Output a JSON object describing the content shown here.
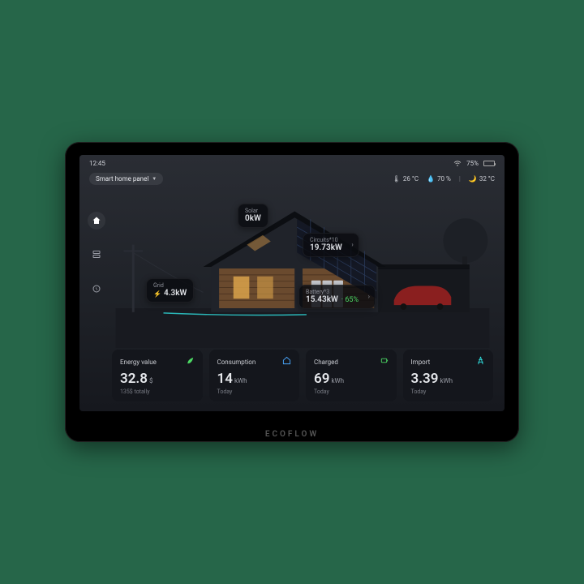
{
  "branding": "ECOFLOW",
  "statusbar": {
    "time": "12:45",
    "battery_pct": "75%"
  },
  "header": {
    "title": "Smart home panel",
    "temp": "26 °C",
    "humidity": "70 %",
    "outside_temp": "32 °C"
  },
  "scene": {
    "solar": {
      "label": "Solar",
      "value": "0kW"
    },
    "circuits": {
      "label": "Circuits*10",
      "value": "19.73kW"
    },
    "grid": {
      "label": "Grid",
      "value": "4.3kW"
    },
    "battery": {
      "label": "Battery*3",
      "value": "15.43kW",
      "soc": "· 65%"
    }
  },
  "cards": {
    "energy": {
      "label": "Energy value",
      "value": "32.8",
      "unit": "$",
      "sub": "135$ totally"
    },
    "consumption": {
      "label": "Consumption",
      "value": "14",
      "unit": "kWh",
      "sub": "Today"
    },
    "charged": {
      "label": "Charged",
      "value": "69",
      "unit": "kWh",
      "sub": "Today"
    },
    "import": {
      "label": "Import",
      "value": "3.39",
      "unit": "kWh",
      "sub": "Today"
    }
  }
}
